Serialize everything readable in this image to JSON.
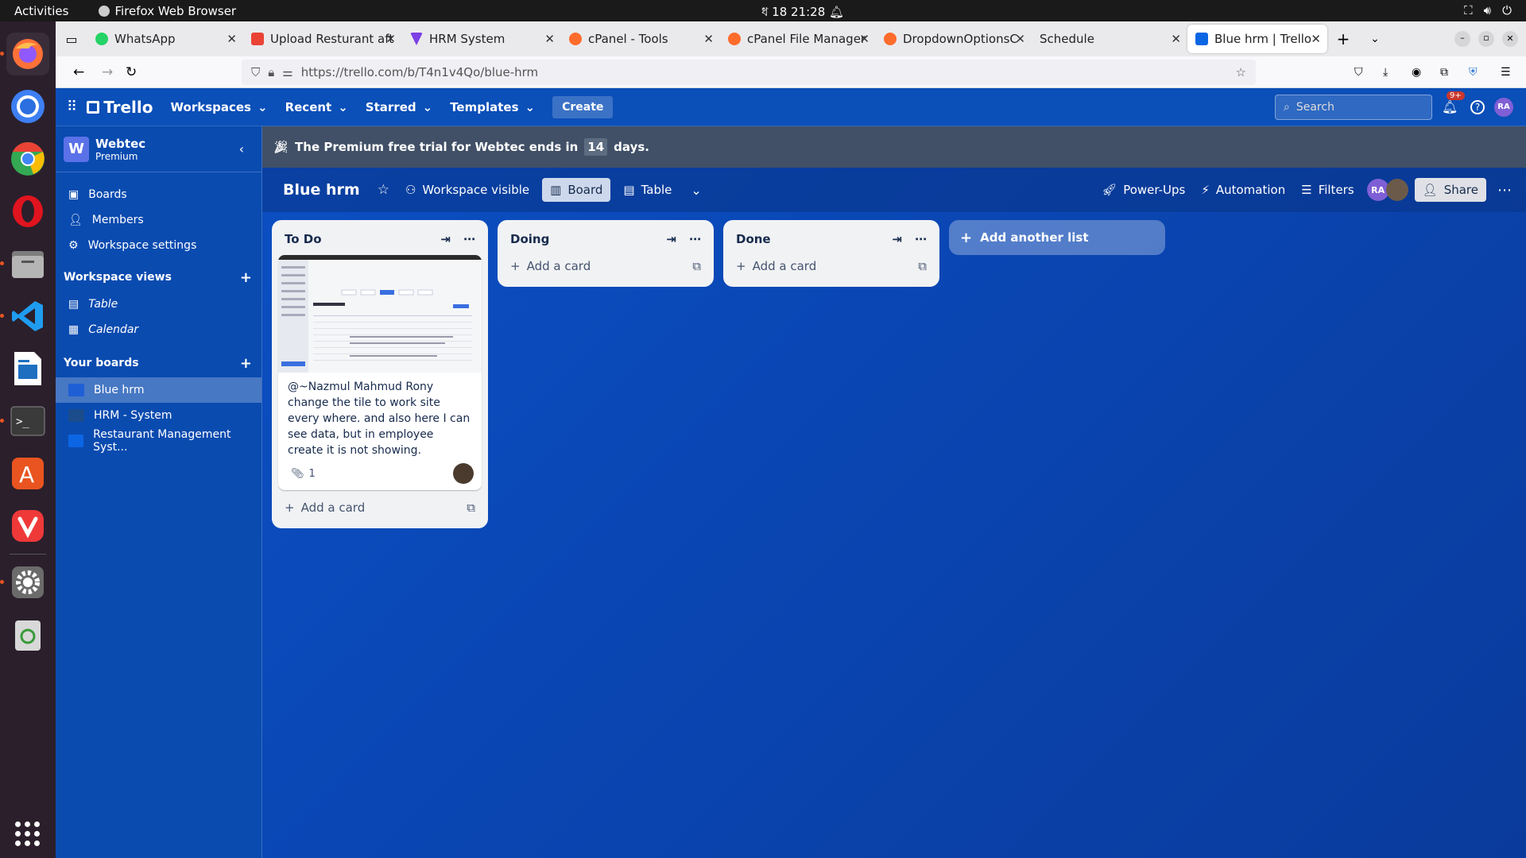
{
  "os": {
    "activities": "Activities",
    "app_name": "Firefox Web Browser",
    "clock": "ধ 18  21:28"
  },
  "tabs": [
    {
      "label": "WhatsApp",
      "color": "#25d366"
    },
    {
      "label": "Upload Resturant aft",
      "color": "#ea4335"
    },
    {
      "label": "HRM System",
      "color": "#7b3fe4"
    },
    {
      "label": "cPanel - Tools",
      "color": "#ff6c2c"
    },
    {
      "label": "cPanel File Manager",
      "color": "#ff6c2c"
    },
    {
      "label": "DropdownOptionsC",
      "color": "#ff6c2c"
    },
    {
      "label": "Schedule",
      "color": "#ffffff"
    },
    {
      "label": "Blue hrm | Trello",
      "color": "#0c66e4"
    }
  ],
  "url": "https://trello.com/b/T4n1v4Qo/blue-hrm",
  "trello": {
    "logo": "Trello",
    "nav": [
      "Workspaces",
      "Recent",
      "Starred",
      "Templates"
    ],
    "create": "Create",
    "search_placeholder": "Search",
    "notif_badge": "9+",
    "user_initials": "RA"
  },
  "sidebar": {
    "workspace_letter": "W",
    "workspace_name": "Webtec",
    "workspace_plan": "Premium",
    "items": [
      "Boards",
      "Members",
      "Workspace settings"
    ],
    "views_header": "Workspace views",
    "views": [
      "Table",
      "Calendar"
    ],
    "boards_header": "Your boards",
    "boards": [
      {
        "name": "Blue hrm",
        "color": "#1f5fd6"
      },
      {
        "name": "HRM - System",
        "color": "#1b4c8c"
      },
      {
        "name": "Restaurant Management Syst...",
        "color": "#0c66e4"
      }
    ]
  },
  "banner": {
    "pre": "The Premium free trial for Webtec ends in",
    "days_num": "14",
    "post": "days."
  },
  "board": {
    "title": "Blue hrm",
    "visibility": "Workspace visible",
    "view_board": "Board",
    "view_table": "Table",
    "powerups": "Power-Ups",
    "automation": "Automation",
    "filters": "Filters",
    "share": "Share"
  },
  "lists": [
    {
      "title": "To Do",
      "add_card": "Add a card",
      "card": {
        "text": "@~Nazmul Mahmud Rony change the tile to work site every where. and also here I can see data, but in employee create it is not showing.",
        "attachments": "1"
      }
    },
    {
      "title": "Doing",
      "add_card": "Add a card"
    },
    {
      "title": "Done",
      "add_card": "Add a card"
    }
  ],
  "add_list": "Add another list"
}
